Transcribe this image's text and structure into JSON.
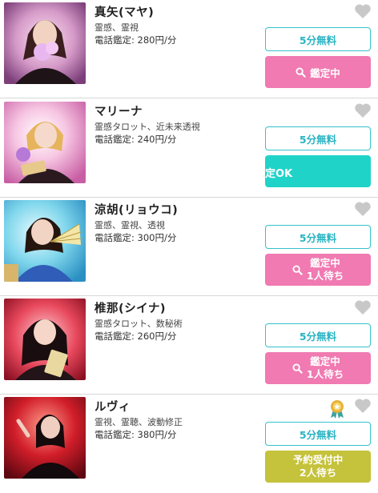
{
  "free_label": "5分無料",
  "colors": {
    "pink": "#f07ab1",
    "teal": "#1fd3c9",
    "olive": "#c5c23b",
    "free_border": "#35c2cc",
    "heart": "#c8c8c8"
  },
  "items": [
    {
      "name": "真矢(マヤ)",
      "genres": "霊感、霊視",
      "price": "電話鑑定: 280円/分",
      "status_line1": "鑑定中",
      "status_line2": "",
      "status_style": "pink",
      "status_icon": "search-icon"
    },
    {
      "name": "マリーナ",
      "genres": "霊感タロット、近未来透視",
      "price": "電話鑑定: 240円/分",
      "status_line1": "定OK",
      "status_line2": "",
      "status_style": "teal"
    },
    {
      "name": "涼胡(リョウコ)",
      "genres": "霊感、霊視、透視",
      "price": "電話鑑定: 300円/分",
      "status_line1": "鑑定中",
      "status_line2": "1人待ち",
      "status_style": "pink",
      "status_icon": "search-icon"
    },
    {
      "name": "椎那(シイナ)",
      "genres": "霊感タロット、数秘術",
      "price": "電話鑑定: 260円/分",
      "status_line1": "鑑定中",
      "status_line2": "1人待ち",
      "status_style": "pink",
      "status_icon": "search-icon"
    },
    {
      "name": "ルヴィ",
      "genres": "霊視、霊聴、波動修正",
      "price": "電話鑑定: 380円/分",
      "status_line1": "予約受付中",
      "status_line2": "2人待ち",
      "status_style": "olive",
      "badge_icon": "award-ribbon-icon"
    }
  ]
}
